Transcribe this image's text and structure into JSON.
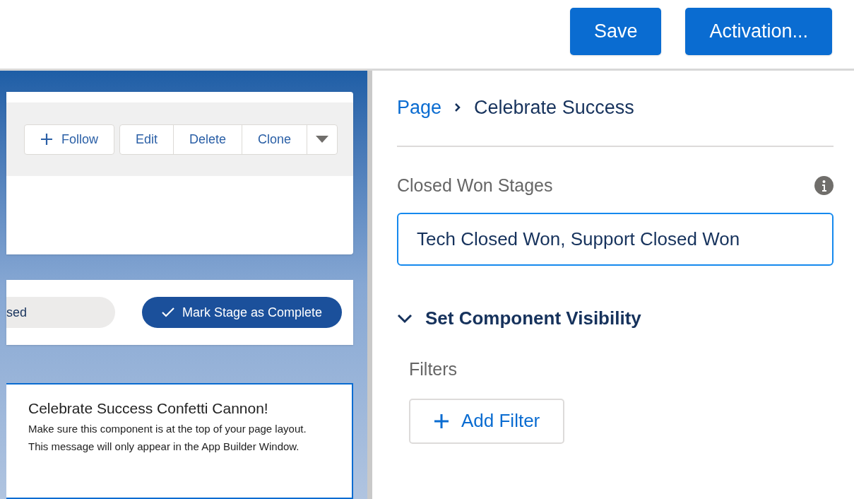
{
  "header": {
    "buttons": [
      {
        "label": "Save"
      },
      {
        "label": "Activation..."
      }
    ]
  },
  "canvas": {
    "record_actions": {
      "follow": "Follow",
      "buttons": [
        "Edit",
        "Delete",
        "Clone"
      ]
    },
    "path": {
      "stage": "sed",
      "complete_button": "Mark Stage as Complete"
    },
    "component": {
      "title": "Celebrate Success Confetti Cannon!",
      "lines": [
        "Make sure this component is at the top of your page layout.",
        "This message will only appear in the App Builder Window."
      ]
    }
  },
  "panel": {
    "breadcrumb": {
      "parent": "Page",
      "current": "Celebrate Success"
    },
    "field": {
      "label": "Closed Won Stages",
      "value": "Tech Closed Won, Support Closed Won"
    },
    "section": {
      "title": "Set Component Visibility",
      "expanded": true
    },
    "filters_label": "Filters",
    "add_filter": "Add Filter"
  }
}
